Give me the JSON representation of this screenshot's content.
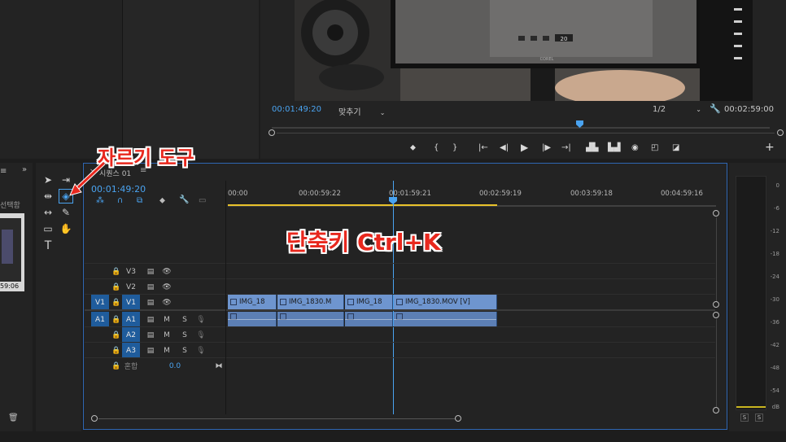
{
  "program_monitor": {
    "timecode_current": "00:01:49:20",
    "fit_label": "맞추기",
    "resolution": "1/2",
    "timecode_duration": "00:02:59:00",
    "monitor_brand": "COREL",
    "screen_timer": "20"
  },
  "project_panel": {
    "label": "선택함",
    "thumb_time": "59:06"
  },
  "timeline": {
    "sequence_name": "시퀀스 01",
    "timecode": "00:01:49:20",
    "ruler": [
      "00:00",
      "00:00:59:22",
      "00:01:59:21",
      "00:02:59:19",
      "00:03:59:18",
      "00:04:59:16"
    ],
    "tracks": {
      "v3": "V3",
      "v2": "V2",
      "v1": "V1",
      "v1_src": "V1",
      "a1": "A1",
      "a1_src": "A1",
      "a2": "A2",
      "a3": "A3",
      "mix": "혼합",
      "mix_value": "0.0"
    },
    "m_label": "M",
    "s_label": "S",
    "video_clips": [
      "IMG_18",
      "IMG_1830.M",
      "IMG_18",
      "IMG_1830.MOV [V]"
    ]
  },
  "meter": {
    "labels": [
      "0",
      "-6",
      "-12",
      "-18",
      "-24",
      "-30",
      "-36",
      "-42",
      "-48",
      "-54"
    ],
    "db": "dB",
    "solo_left": "S",
    "solo_right": "S"
  },
  "annotations": {
    "razor_tool": "자르기 도구",
    "shortcut": "단축키 Ctrl+K"
  },
  "colors": {
    "accent_blue": "#4aa3f0",
    "clip_blue": "#6e95cf",
    "annotation_red": "#e8281e",
    "work_area": "#e8c22a"
  }
}
